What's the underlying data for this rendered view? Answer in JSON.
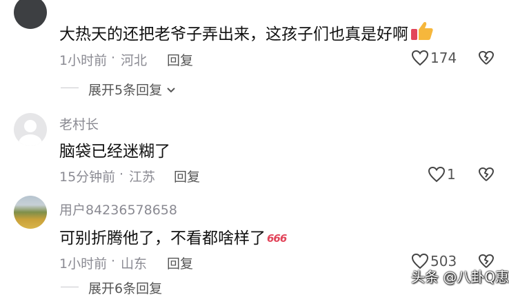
{
  "header_fragment": "",
  "comments": [
    {
      "username": "",
      "text": "大热天的还把老爷子弄出来，这孩子们也真是好啊",
      "time": "1小时前",
      "location": "河北",
      "reply_label": "回复",
      "likes": "174",
      "expand_label": "展开5条回复",
      "emoji": "thumbs-up-icon"
    },
    {
      "username": "老村长",
      "text": "脑袋已经迷糊了",
      "time": "15分钟前",
      "location": "江苏",
      "reply_label": "回复",
      "likes": "1"
    },
    {
      "username": "用户84236578658",
      "text": "可别折腾他了，不看都啥样了",
      "emoji_text": "666",
      "time": "1小时前",
      "location": "山东",
      "reply_label": "回复",
      "likes": "503",
      "expand_label": "展开6条回复"
    }
  ],
  "watermark": "头条 @八卦Q恵",
  "colors": {
    "meta": "#8a8a92",
    "text": "#111111",
    "badge": "#e2455a"
  }
}
